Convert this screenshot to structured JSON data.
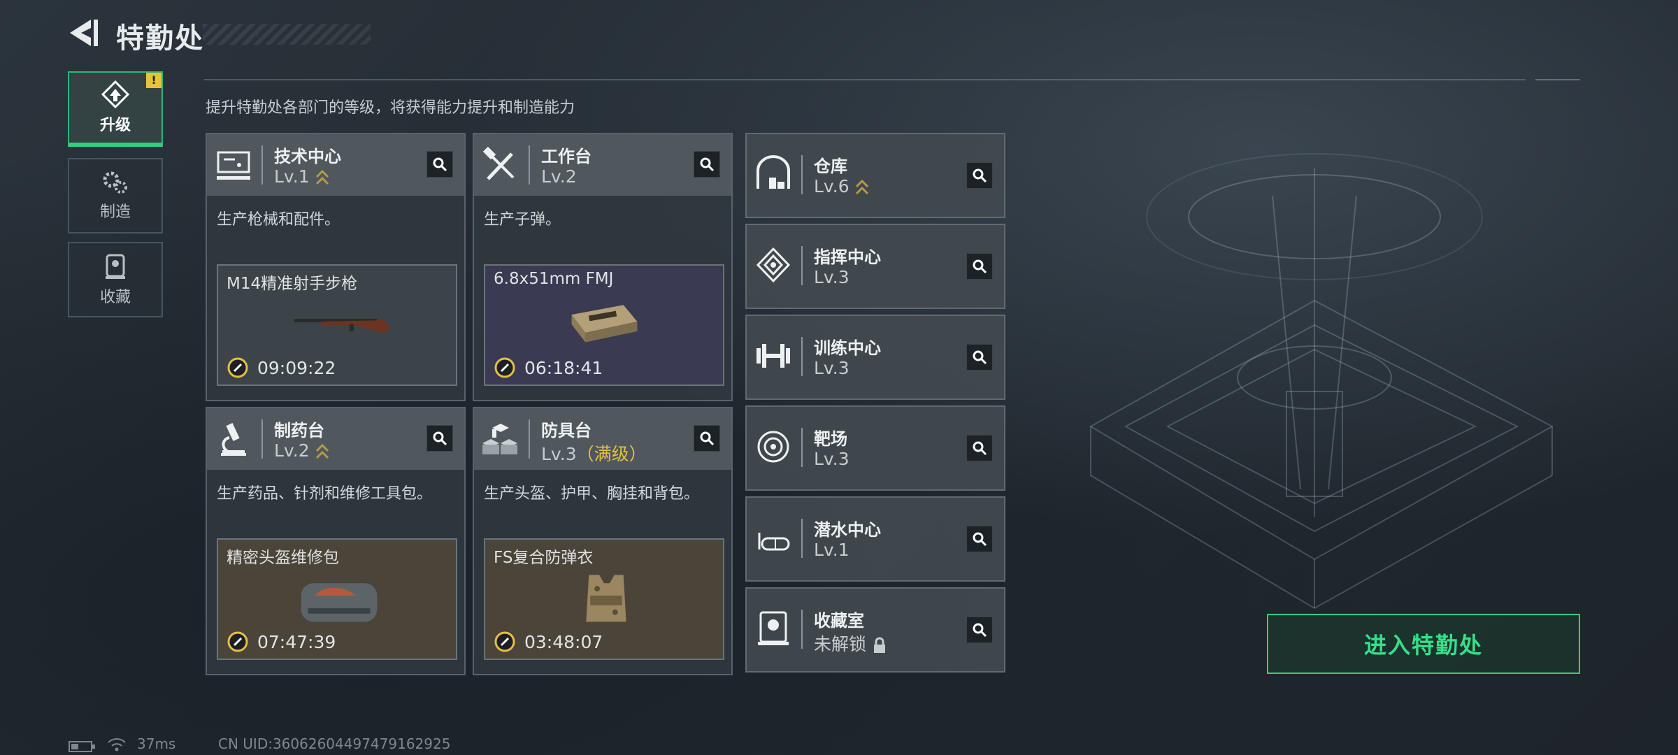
{
  "header": {
    "title": "特勤处"
  },
  "side_tabs": [
    {
      "label": "升级",
      "icon": "upgrade-icon",
      "active": true,
      "alert": "!"
    },
    {
      "label": "制造",
      "icon": "gears-icon",
      "active": false
    },
    {
      "label": "收藏",
      "icon": "collection-icon",
      "active": false
    }
  ],
  "subtitle": "提升特勤处各部门的等级，将获得能力提升和制造能力",
  "departments": [
    {
      "name": "技术中心",
      "level": "Lv.1",
      "upgradable": true,
      "icon": "computer-icon",
      "desc": "生产枪械和配件。",
      "craft": {
        "item": "M14精准射手步枪",
        "timer": "09:09:22",
        "image": "rifle-icon"
      }
    },
    {
      "name": "工作台",
      "level": "Lv.2",
      "upgradable": false,
      "icon": "tools-icon",
      "desc": "生产子弹。",
      "craft": {
        "item": "6.8x51mm FMJ",
        "timer": "06:18:41",
        "image": "ammo-box-icon"
      }
    },
    {
      "name": "制药台",
      "level": "Lv.2",
      "upgradable": true,
      "icon": "microscope-icon",
      "desc": "生产药品、针剂和维修工具包。",
      "craft": {
        "item": "精密头盔维修包",
        "timer": "07:47:39",
        "image": "repair-bag-icon"
      }
    },
    {
      "name": "防具台",
      "level": "Lv.3",
      "max_label": "（满级）",
      "upgradable": false,
      "icon": "cubes-icon",
      "desc": "生产头盔、护甲、胸挂和背包。",
      "craft": {
        "item": "FS复合防弹衣",
        "timer": "03:48:07",
        "image": "vest-icon"
      }
    }
  ],
  "small_departments": [
    {
      "name": "仓库",
      "level": "Lv.6",
      "upgradable": true,
      "icon": "warehouse-icon"
    },
    {
      "name": "指挥中心",
      "level": "Lv.3",
      "upgradable": false,
      "icon": "command-icon"
    },
    {
      "name": "训练中心",
      "level": "Lv.3",
      "upgradable": false,
      "icon": "dumbbell-icon"
    },
    {
      "name": "靶场",
      "level": "Lv.3",
      "upgradable": false,
      "icon": "target-icon"
    },
    {
      "name": "潜水中心",
      "level": "Lv.1",
      "upgradable": false,
      "icon": "goggles-icon"
    },
    {
      "name": "收藏室",
      "level": "未解锁",
      "locked": true,
      "icon": "trophy-icon"
    }
  ],
  "enter_button": "进入特勤处",
  "status_bar": {
    "ping": "37ms",
    "uid": "CN UID:36062604497479162925"
  },
  "colors": {
    "accent": "#2fd07f",
    "maxed": "#e5bf45",
    "upgrade_chevron": "#b59a4a"
  }
}
